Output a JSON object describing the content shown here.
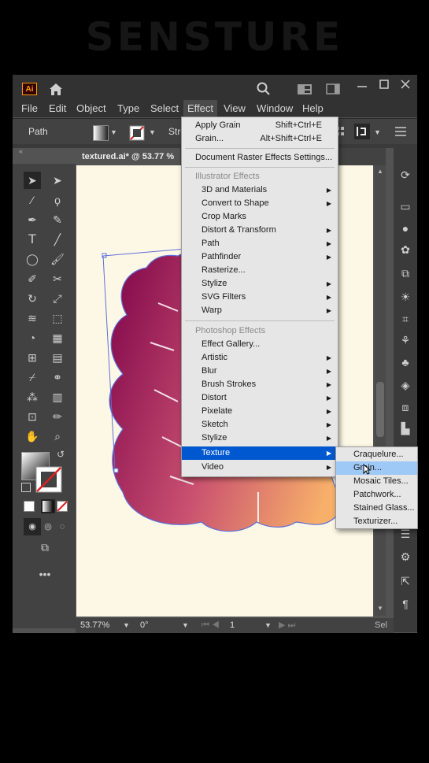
{
  "watermark": "SENSTURE",
  "app": {
    "logo": "Ai",
    "icons": [
      "home-icon",
      "search-icon",
      "arrange-documents-icon",
      "workspace-icon",
      "minimize-icon",
      "maximize-icon",
      "close-icon"
    ]
  },
  "menubar": [
    "File",
    "Edit",
    "Object",
    "Type",
    "Select",
    "Effect",
    "View",
    "Window",
    "Help"
  ],
  "control": {
    "label": "Path",
    "stroke_partial": "Stro"
  },
  "tab": {
    "label": "textured.ai* @ 53.77 %"
  },
  "effect_menu": {
    "apply_grain": {
      "label": "Apply Grain",
      "shortcut": "Shift+Ctrl+E"
    },
    "grain": {
      "label": "Grain...",
      "shortcut": "Alt+Shift+Ctrl+E"
    },
    "doc_raster": "Document Raster Effects Settings...",
    "illustrator_header": "Illustrator Effects",
    "illustrator_items": [
      "3D and Materials",
      "Convert to Shape",
      "Crop Marks",
      "Distort & Transform",
      "Path",
      "Pathfinder",
      "Rasterize...",
      "Stylize",
      "SVG Filters",
      "Warp"
    ],
    "photoshop_header": "Photoshop Effects",
    "photoshop_items": [
      "Effect Gallery...",
      "Artistic",
      "Blur",
      "Brush Strokes",
      "Distort",
      "Pixelate",
      "Sketch",
      "Stylize",
      "Texture",
      "Video"
    ]
  },
  "texture_submenu": [
    "Craquelure...",
    "Grain...",
    "Mosaic Tiles...",
    "Patchwork...",
    "Stained Glass...",
    "Texturizer..."
  ],
  "status": {
    "zoom": "53.77%",
    "rotation": "0°",
    "artboard": "1",
    "mode": "Sel"
  },
  "colors": {
    "accent_highlight": "#0058d0",
    "submenu_highlight": "#9ec8f5",
    "leaf_start": "#8a1050",
    "leaf_end": "#f7b06a"
  }
}
